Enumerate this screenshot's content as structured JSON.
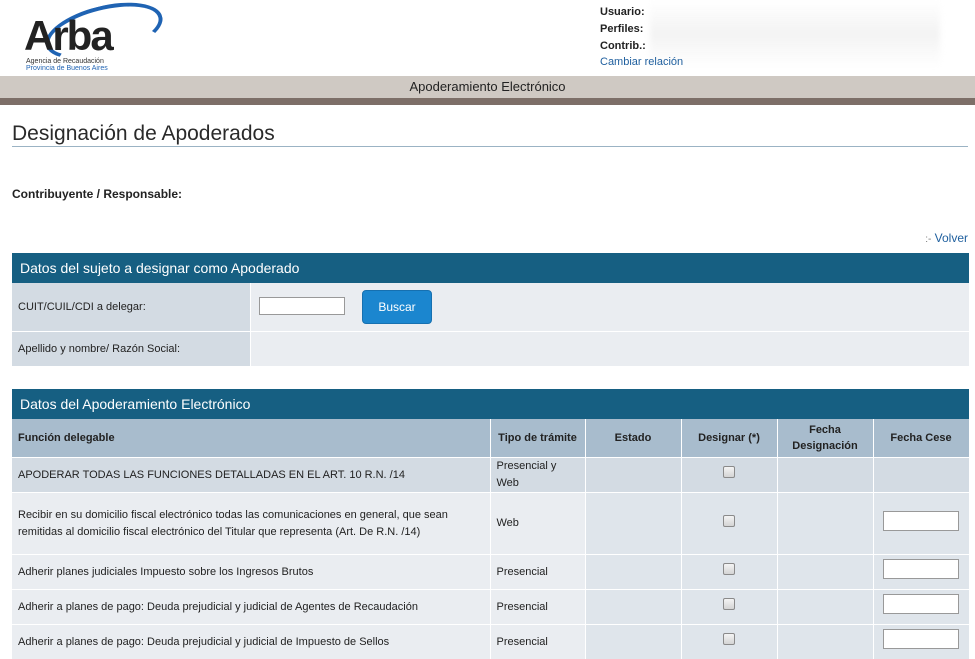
{
  "logo": {
    "word": "Arba",
    "line1": "Agencia de Recaudación",
    "line2": "Provincia de Buenos Aires"
  },
  "user": {
    "usuario_label": "Usuario:",
    "perfiles_label": "Perfiles:",
    "contrib_label": "Contrib.:",
    "cambiar_link": "Cambiar relación"
  },
  "titlebar": "Apoderamiento Electrónico",
  "page": {
    "title": "Designación de Apoderados",
    "contribuyente_label": "Contribuyente / Responsable:",
    "volver_prefix": ":-",
    "volver": "Volver"
  },
  "panel1": {
    "title": "Datos del sujeto a designar como Apoderado",
    "cuit_label": "CUIT/CUIL/CDI a delegar:",
    "cuit_value": "",
    "buscar": "Buscar",
    "nombre_label": "Apellido y nombre/ Razón Social:"
  },
  "panel2": {
    "title": "Datos del Apoderamiento Electrónico",
    "headers": {
      "funcion": "Función delegable",
      "tipo": "Tipo de trámite",
      "estado": "Estado",
      "designar": "Designar (*)",
      "fecha_designacion": "Fecha Designación",
      "fecha_cese": "Fecha Cese"
    },
    "rows": [
      {
        "funcion": "APODERAR TODAS LAS FUNCIONES DETALLADAS EN EL ART. 10 R.N. /14",
        "tipo": "Presencial y Web"
      },
      {
        "funcion": "Recibir en su domicilio fiscal electrónico todas las comunicaciones en general, que sean remitidas al domicilio fiscal electrónico del Titular que representa (Art. De R.N. /14)",
        "tipo": "Web"
      },
      {
        "funcion": "Adherir planes judiciales Impuesto sobre los Ingresos Brutos",
        "tipo": "Presencial"
      },
      {
        "funcion": "Adherir a planes de pago: Deuda prejudicial y judicial de Agentes de Recaudación",
        "tipo": "Presencial"
      },
      {
        "funcion": "Adherir a planes de pago: Deuda prejudicial y judicial de Impuesto de Sellos",
        "tipo": "Presencial"
      }
    ]
  },
  "colors": {
    "panel_header": "#165f82",
    "table_header": "#a8bccd",
    "button": "#1b86cf",
    "link": "#1f5f9e"
  }
}
